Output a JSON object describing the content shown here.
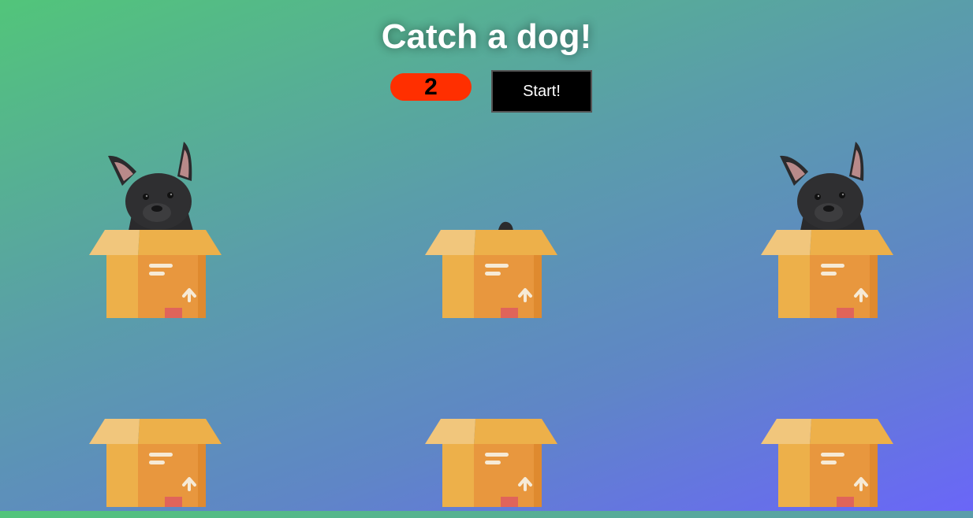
{
  "game": {
    "title": "Catch a dog!",
    "score": "2",
    "start_label": "Start!"
  },
  "colors": {
    "score_badge": "#ff2f00",
    "start_button": "#000000",
    "gradient_start": "#52c57a",
    "gradient_end": "#6a66f8",
    "box_front": "#e8973e",
    "box_side": "#edb04a",
    "box_flap_light": "#f1c67c"
  },
  "holes": [
    {
      "id": 1,
      "dog": "full"
    },
    {
      "id": 2,
      "dog": "peek"
    },
    {
      "id": 3,
      "dog": "full"
    },
    {
      "id": 4,
      "dog": "none"
    },
    {
      "id": 5,
      "dog": "none"
    },
    {
      "id": 6,
      "dog": "none"
    }
  ],
  "icons": {
    "dog": "french-bulldog-icon",
    "box": "cardboard-box-icon"
  }
}
